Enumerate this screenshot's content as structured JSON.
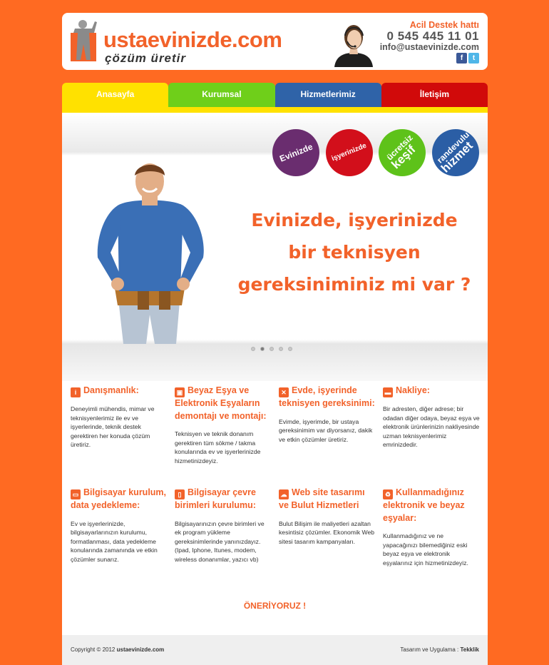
{
  "header": {
    "logo_text": "ustaevinizde.com",
    "logo_sub": "çözüm üretir",
    "support_title": "Acil Destek hattı",
    "support_phone": "0 545 445 11 01",
    "support_email": "info@ustaevinizde.com",
    "social": [
      "facebook-icon",
      "twitter-icon"
    ]
  },
  "nav": {
    "items": [
      "Anasayfa",
      "Kurumsal",
      "Hizmetlerimiz",
      "İletişim"
    ],
    "colors": [
      "#ffe100",
      "#6fcf1a",
      "#2f63a8",
      "#d10a0a"
    ]
  },
  "slider": {
    "badges": [
      {
        "text": "Evinizde",
        "color": "#6a2d6f"
      },
      {
        "text": "işyerinizde",
        "color": "#d20f1b"
      },
      {
        "line1": "ücretsiz",
        "line2": "keşif",
        "color": "#5ec21a"
      },
      {
        "line1": "randevulu",
        "line2": "hizmet",
        "color": "#2b5ea5"
      }
    ],
    "headline": [
      "Evinizde, işyerinizde",
      "bir teknisyen",
      "gereksiniminiz mi var ?"
    ],
    "active_slide": 2,
    "slide_count": 5
  },
  "features": [
    {
      "icon": "info-icon",
      "title": "Danışmanlık:",
      "text": "Deneyimli mühendis, mimar ve teknisyenlerimiz ile ev ve işyerlerinde, teknik destek gerektiren her konuda çözüm üretiriz."
    },
    {
      "icon": "washer-icon",
      "title": "Beyaz Eşya ve Elektronik Eşyaların demontajı ve montajı:",
      "text": "Teknisyen ve teknik donanım gerektiren tüm sökme / takma konularında ev ve işyerlerinizde hizmetinizdeyiz."
    },
    {
      "icon": "tools-icon",
      "title": "Evde, işyerinde teknisyen gereksinimi:",
      "text": "Evimde, işyerimde, bir ustaya gereksinimim var diyorsanız, dakik ve etkin çözümler üretiriz."
    },
    {
      "icon": "truck-icon",
      "title": "Nakliye:",
      "text": "Bir adresten, diğer adrese; bir odadan diğer odaya, beyaz eşya ve elektronik ürünlerinizin nakliyesinde uzman teknisyenlerimiz emrinizdedir."
    },
    {
      "icon": "laptop-icon",
      "title": "Bilgisayar kurulum, data yedekleme:",
      "text": "Ev ve işyerlerinizde, bilgisayarlarınızın kurulumu, formatlanması, data yedekleme konularında zamanında ve etkin çözümler sunarız."
    },
    {
      "icon": "phone-icon",
      "title": "Bilgisayar çevre birimleri kurulumu:",
      "text": "Bilgisayarınızın çevre birimleri ve ek program yükleme gereksinimlerinde yanınızdayız. (Ipad, Iphone, Itunes, modem, wireless donanımlar, yazıcı vb)"
    },
    {
      "icon": "cloud-icon",
      "title": "Web site tasarımı ve Bulut Hizmetleri",
      "text": "Bulut Bilişim ile maliyetleri azaltan kesintisiz çözümler. Ekonomik Web sitesi tasarım kampanyaları."
    },
    {
      "icon": "recycle-icon",
      "title": "Kullanmadığınız elektronik ve beyaz eşyalar:",
      "text": "Kullanmadığınız ve ne yapacağınızı bilemediğiniz eski beyaz eşya ve elektronik eşyalarınız için hizmetinizdeyiz."
    }
  ],
  "oneri": "ÖNERİYORUZ !",
  "footer": {
    "copyright": "Copyright © 2012",
    "site": "ustaevinizde.com",
    "design_label": "Tasarım ve Uygulama :",
    "designer": "Tekklik"
  }
}
